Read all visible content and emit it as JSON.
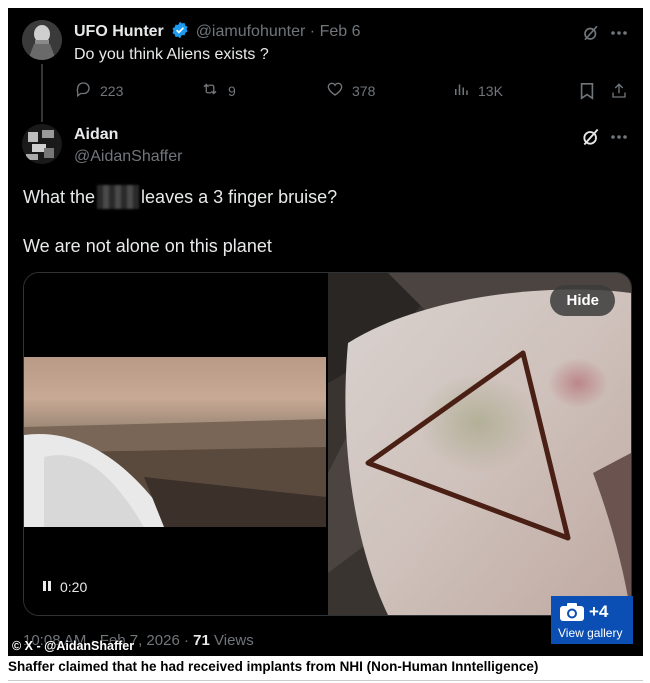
{
  "tweet": {
    "author_name": "UFO Hunter",
    "handle": "@iamufohunter",
    "separator": "·",
    "date": "Feb 6",
    "text": "Do you think Aliens exists ?",
    "replies": "223",
    "reposts": "9",
    "likes": "378",
    "views": "13K"
  },
  "reply": {
    "author_name": "Aidan",
    "handle": "@AidanShaffer",
    "line1_before": "What the",
    "line1_after": "leaves a 3 finger bruise?",
    "line2": "We are not alone on this planet",
    "video_time": "0:20",
    "hide_label": "Hide",
    "timestamp_time": "10:08 AM",
    "timestamp_date": "Feb 7, 2026",
    "views_count": "71",
    "views_label": "Views"
  },
  "overlay": {
    "credit": "© X - @AidanShaffer",
    "gallery_count": "+4",
    "gallery_label": "View gallery"
  },
  "caption": "Shaffer claimed that he had received implants from NHI (Non-Human Inntelligence)",
  "colors": {
    "verified": "#1d9bf0",
    "gallery_bg": "#0b4fb5"
  }
}
